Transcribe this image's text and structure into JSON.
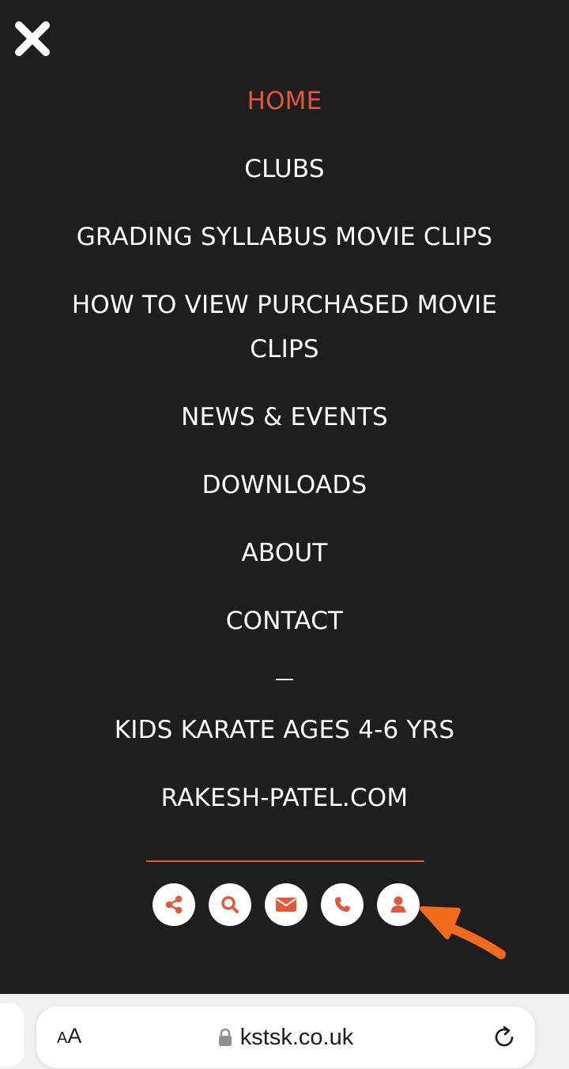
{
  "colors": {
    "background": "#1f1e1f",
    "accent": "#e2593a",
    "menu_text": "#ffffff",
    "arrow": "#f26a1b",
    "browser_bar": "#f1f1f3"
  },
  "menu": {
    "close_icon": "close-icon",
    "items": [
      {
        "label": "HOME",
        "active": true
      },
      {
        "label": "CLUBS"
      },
      {
        "label": "GRADING SYLLABUS MOVIE CLIPS"
      },
      {
        "label": "HOW TO VIEW PURCHASED MOVIE CLIPS"
      },
      {
        "label": "NEWS & EVENTS"
      },
      {
        "label": "DOWNLOADS"
      },
      {
        "label": "ABOUT"
      },
      {
        "label": "CONTACT"
      }
    ],
    "separator": "—",
    "extra_items": [
      {
        "label": "KIDS KARATE AGES 4-6 YRS"
      },
      {
        "label": "RAKESH-PATEL.COM"
      }
    ]
  },
  "action_icons": [
    "share-icon",
    "search-icon",
    "envelope-icon",
    "phone-icon",
    "user-icon"
  ],
  "browser": {
    "text_size_small": "A",
    "text_size_big": "A",
    "url": "kstsk.co.uk",
    "lock_icon": "lock-icon",
    "reload_icon": "reload-icon"
  }
}
